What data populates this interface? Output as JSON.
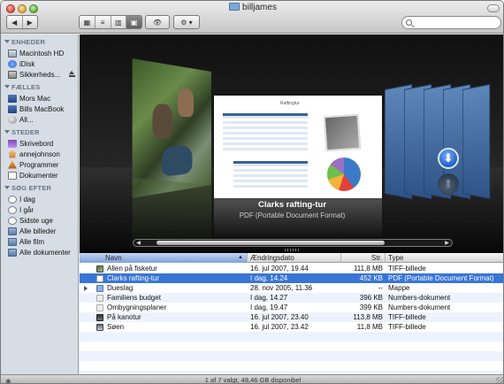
{
  "window": {
    "title": "billjames"
  },
  "toolbar": {
    "back_label": "◀",
    "forward_label": "▶",
    "view_modes": [
      "icons",
      "list",
      "columns",
      "coverflow"
    ],
    "quicklook_label": "👁",
    "action_label": "⚙ ▾",
    "search_placeholder": ""
  },
  "sidebar": {
    "sections": [
      {
        "title": "ENHEDER",
        "items": [
          {
            "label": "Macintosh HD",
            "icon": "hd-icon"
          },
          {
            "label": "iDisk",
            "icon": "idisk-icon"
          },
          {
            "label": "Sikkerheds...",
            "icon": "volume-icon",
            "eject": true
          }
        ]
      },
      {
        "title": "FÆLLES",
        "items": [
          {
            "label": "Mors Mac",
            "icon": "computer-icon"
          },
          {
            "label": "Bills MacBook",
            "icon": "computer-icon"
          },
          {
            "label": "All...",
            "icon": "globe-icon"
          }
        ]
      },
      {
        "title": "STEDER",
        "items": [
          {
            "label": "Skrivebord",
            "icon": "desktop-icon"
          },
          {
            "label": "annejohnson",
            "icon": "home-icon"
          },
          {
            "label": "Programmer",
            "icon": "applications-icon"
          },
          {
            "label": "Dokumenter",
            "icon": "documents-icon"
          }
        ]
      },
      {
        "title": "SØG EFTER",
        "items": [
          {
            "label": "I dag",
            "icon": "clock-icon"
          },
          {
            "label": "I går",
            "icon": "clock-icon"
          },
          {
            "label": "Sidste uge",
            "icon": "clock-icon"
          },
          {
            "label": "Alle billeder",
            "icon": "smart-folder-icon"
          },
          {
            "label": "Alle film",
            "icon": "smart-folder-icon"
          },
          {
            "label": "Alle dokumenter",
            "icon": "smart-folder-icon"
          }
        ]
      }
    ]
  },
  "coverflow": {
    "selected_name": "Clarks rafting-tur",
    "selected_kind": "PDF (Portable Document Format)",
    "doc_title": "Raftingtur",
    "scroll_left": "◀",
    "scroll_right": "▶"
  },
  "list": {
    "columns": [
      "Navn",
      "Ændringsdato",
      "Str.",
      "Type"
    ],
    "sort_indicator": "▲",
    "rows": [
      {
        "name": "Allen på fisketur",
        "date": "16. jul 2007, 19.44",
        "size": "111,8 MB",
        "type": "TIFF-billede",
        "icon": "tiff",
        "selected": false,
        "folder": false
      },
      {
        "name": "Clarks rafting-tur",
        "date": "I dag, 14.24",
        "size": "452 KB",
        "type": "PDF (Portable Document Format)",
        "icon": "pdf",
        "selected": true,
        "folder": false
      },
      {
        "name": "Dueslag",
        "date": "28. nov 2005, 11.36",
        "size": "--",
        "type": "Mappe",
        "icon": "fold",
        "selected": false,
        "folder": true
      },
      {
        "name": "Familiens budget",
        "date": "I dag, 14.27",
        "size": "396 KB",
        "type": "Numbers-dokument",
        "icon": "num",
        "selected": false,
        "folder": false
      },
      {
        "name": "Ombygningsplaner",
        "date": "I dag, 19.47",
        "size": "399 KB",
        "type": "Numbers-dokument",
        "icon": "num",
        "selected": false,
        "folder": false
      },
      {
        "name": "På kanotur",
        "date": "16. jul 2007, 23.40",
        "size": "113,8 MB",
        "type": "TIFF-billede",
        "icon": "tiff2",
        "selected": false,
        "folder": false
      },
      {
        "name": "Søen",
        "date": "16. jul 2007, 23.42",
        "size": "11,8 MB",
        "type": "TIFF-billede",
        "icon": "tiff3",
        "selected": false,
        "folder": false
      }
    ]
  },
  "status": {
    "text": "1 af 7 valgt, 48,46 GB disponibel"
  }
}
